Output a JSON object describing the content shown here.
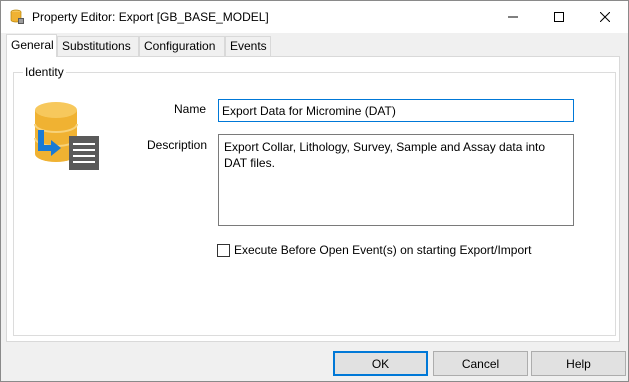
{
  "window": {
    "title": "Property Editor: Export [GB_BASE_MODEL]",
    "icon": "database-icon"
  },
  "tabs": [
    {
      "label": "General",
      "active": true
    },
    {
      "label": "Substitutions",
      "active": false
    },
    {
      "label": "Configuration",
      "active": false
    },
    {
      "label": "Events",
      "active": false
    }
  ],
  "identity": {
    "legend": "Identity",
    "icon": "database-export-icon",
    "name_label": "Name",
    "name_value": "Export Data for Micromine (DAT)",
    "description_label": "Description",
    "description_value": "Export Collar, Lithology, Survey, Sample and Assay data into DAT files.",
    "checkbox_label": "Execute Before Open Event(s) on starting Export/Import",
    "checkbox_checked": false
  },
  "buttons": {
    "ok": "OK",
    "cancel": "Cancel",
    "help": "Help"
  },
  "colors": {
    "accent": "#0078d7",
    "database_gold": "#f0b232",
    "export_arrow": "#1a7ad4",
    "document_gray": "#5a5a5a"
  }
}
